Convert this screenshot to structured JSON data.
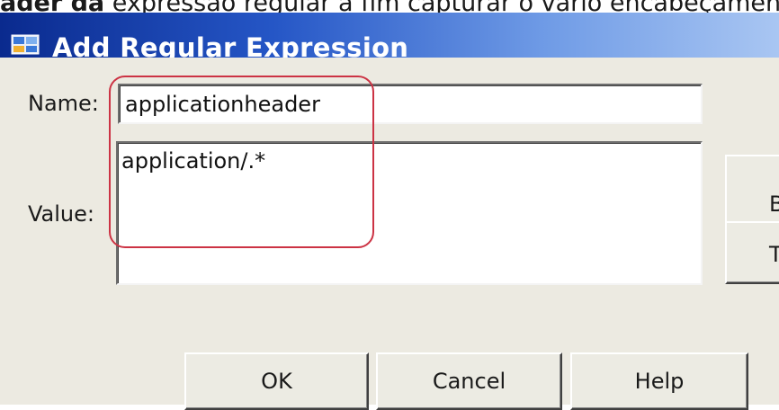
{
  "caption": {
    "bold_part": "ader da",
    "rest": " expressão regular a fim capturar o vário encabeçamento"
  },
  "dialog": {
    "title": "Add Regular Expression",
    "icon": "regex-app-icon"
  },
  "form": {
    "name_label": "Name:",
    "name_value": "applicationheader",
    "value_label": "Value:",
    "value_value": "application/.*"
  },
  "side_buttons": {
    "build_label": "B",
    "test_label": "T"
  },
  "buttons": {
    "ok_label": "OK",
    "cancel_label": "Cancel",
    "help_label": "Help"
  },
  "colors": {
    "highlight": "#cc3344",
    "titlebar_start": "#0a2a8e",
    "titlebar_end": "#a9c6f2",
    "dialog_bg": "#eceae1"
  }
}
